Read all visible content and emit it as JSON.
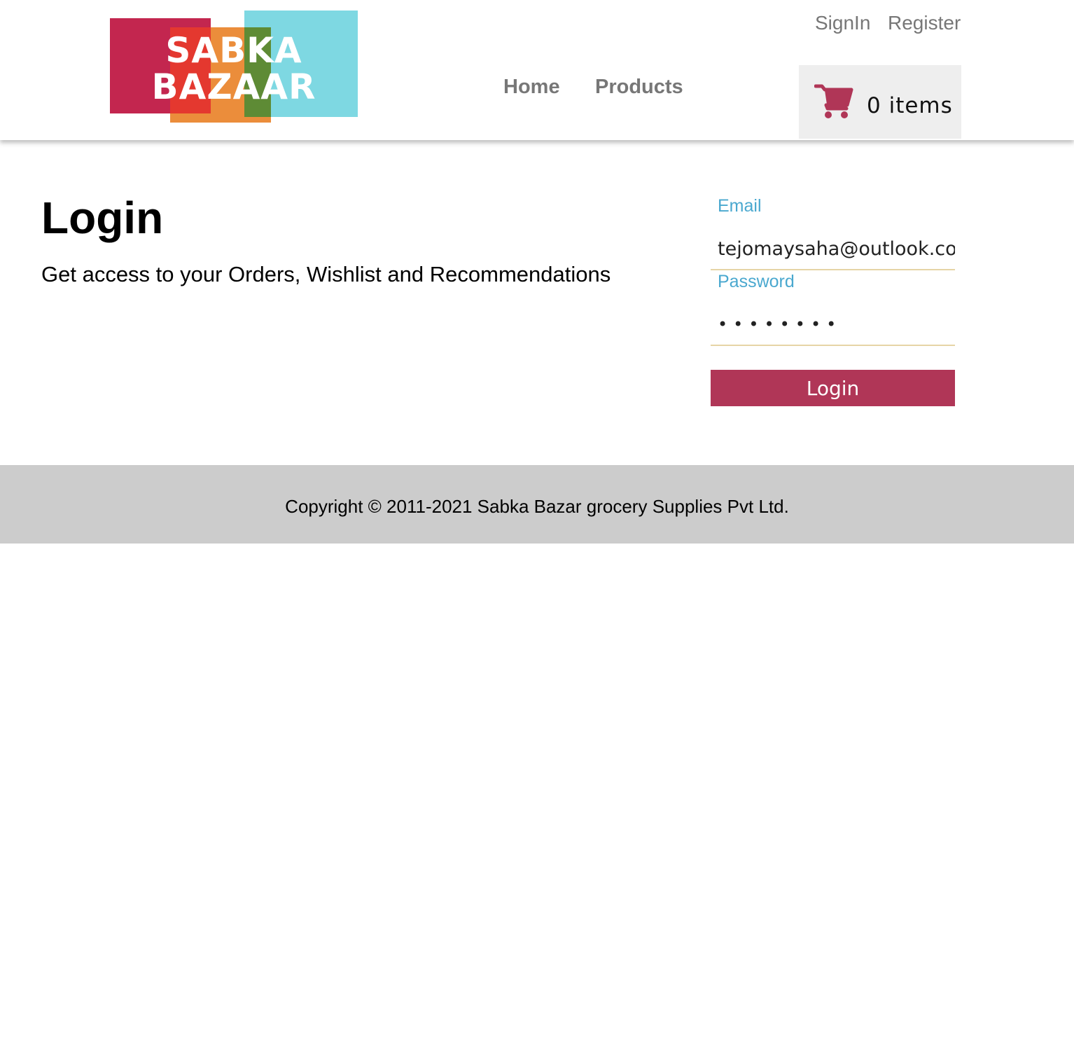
{
  "header": {
    "logo": {
      "line1": "SABKA",
      "line2": "BAZAAR"
    },
    "nav": {
      "home": "Home",
      "products": "Products"
    },
    "auth": {
      "signin": "SignIn",
      "register": "Register"
    },
    "cart": {
      "icon": "cart-icon",
      "label": "0 items",
      "color": "#b03657"
    }
  },
  "main": {
    "title": "Login",
    "subtitle": "Get access to your Orders, Wishlist and Recommendations",
    "form": {
      "email_label": "Email",
      "email_value": "tejomaysaha@outlook.com",
      "password_label": "Password",
      "password_value": "password",
      "submit_label": "Login"
    }
  },
  "footer": {
    "copyright": "Copyright © 2011-2021 Sabka Bazar grocery Supplies Pvt Ltd."
  },
  "colors": {
    "accent": "#b03657",
    "label_blue": "#4aa8cf",
    "footer_bg": "#cccccc"
  }
}
